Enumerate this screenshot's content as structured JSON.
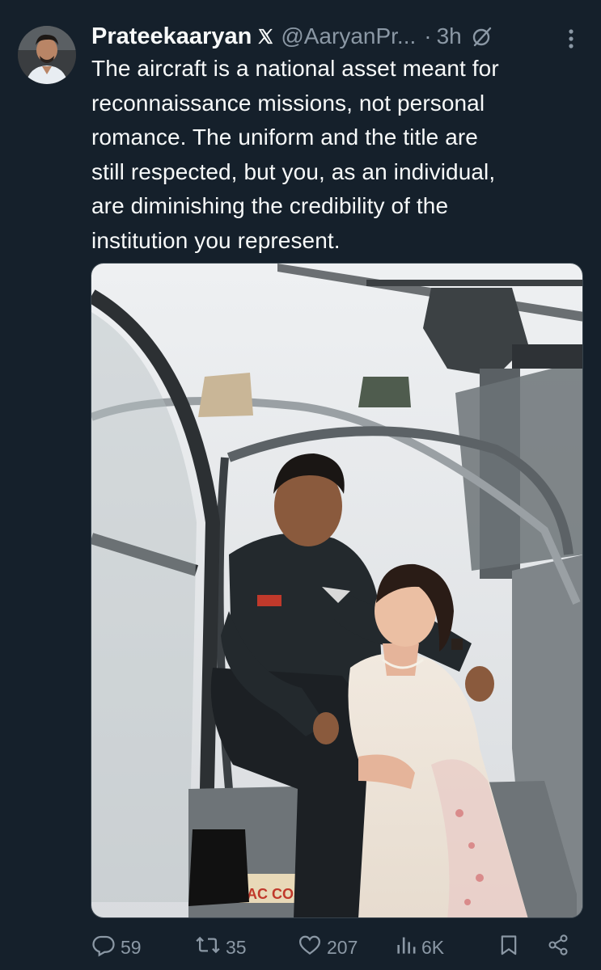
{
  "tweet": {
    "author_name": "Prateekaaryan",
    "handle": "@AaryanPr...",
    "separator": "·",
    "time": "3h",
    "text_lines": [
      "The aircraft is a national asset meant for",
      "reconnaissance missions, not personal",
      "romance. The uniform and the title are",
      "still respected, but you, as an individual,",
      "are diminishing the credibility of the",
      "institution you represent."
    ],
    "image_text": "AC COS"
  },
  "actions": {
    "replies": "59",
    "reposts": "35",
    "likes": "207",
    "views": "6K"
  },
  "icons": {
    "verified_platform": "x-logo-icon",
    "grok": "grok-icon",
    "more": "more-icon",
    "reply": "reply-icon",
    "repost": "repost-icon",
    "like": "heart-icon",
    "views": "views-icon",
    "bookmark": "bookmark-icon",
    "share": "share-icon"
  },
  "colors": {
    "background": "#15202b",
    "text_primary": "#f7f9f9",
    "text_secondary": "#8b98a5",
    "border": "#38444d"
  }
}
